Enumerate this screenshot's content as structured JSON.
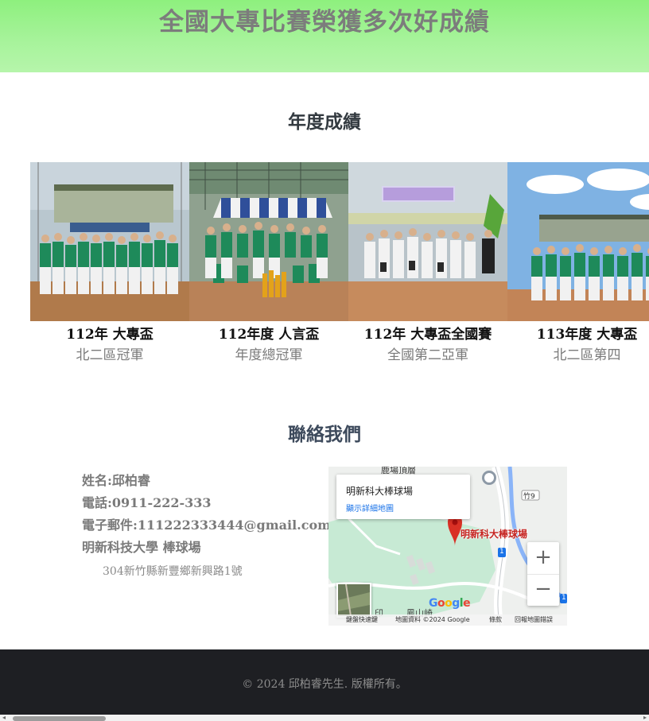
{
  "banner": {
    "title": "全國大專比賽榮獲多次好成績"
  },
  "results": {
    "title": "年度成績",
    "cards": [
      {
        "line1": "112年 大專盃",
        "line2": "北二區冠軍"
      },
      {
        "line1": "112年度 人言盃",
        "line2": "年度總冠軍"
      },
      {
        "line1": "112年 大專盃全國賽",
        "line2": "全國第二亞軍"
      },
      {
        "line1": "113年度 大專盃",
        "line2": "北二區第四"
      }
    ]
  },
  "contact": {
    "title": "聯絡我們",
    "name": "姓名:邱柏睿",
    "phone": "電話:0911-222-333",
    "email": "電子郵件:111222333444@gmail.com",
    "school": "明新科技大學 棒球場",
    "address": "304新竹縣新豐鄉新興路1號"
  },
  "map": {
    "place_name": "明新科大棒球場",
    "detail_link": "顯示詳細地圖",
    "pin_label": "明新科大棒球場",
    "zoom_in": "+",
    "zoom_out": "−",
    "logo": "Google",
    "top_label": "鹿場頂層",
    "road_label": "竹9",
    "road_marker_1": "1",
    "road_marker_2": "1",
    "bottom_label": "鳳山崎",
    "bottom_label2": "印",
    "attribution": {
      "shortcuts": "鍵盤快速鍵",
      "data": "地圖資料 ©2024 Google",
      "terms": "條款",
      "report": "回報地圖錯誤"
    }
  },
  "footer": {
    "copyright": "© 2024 邱柏睿先生. 版權所有。"
  },
  "colors": {
    "banner_green": "#8ef07e",
    "footer_bg": "#1e1f23",
    "team_green": "#1e8a5a",
    "pin_red": "#d93025",
    "link_blue": "#1a73e8"
  }
}
